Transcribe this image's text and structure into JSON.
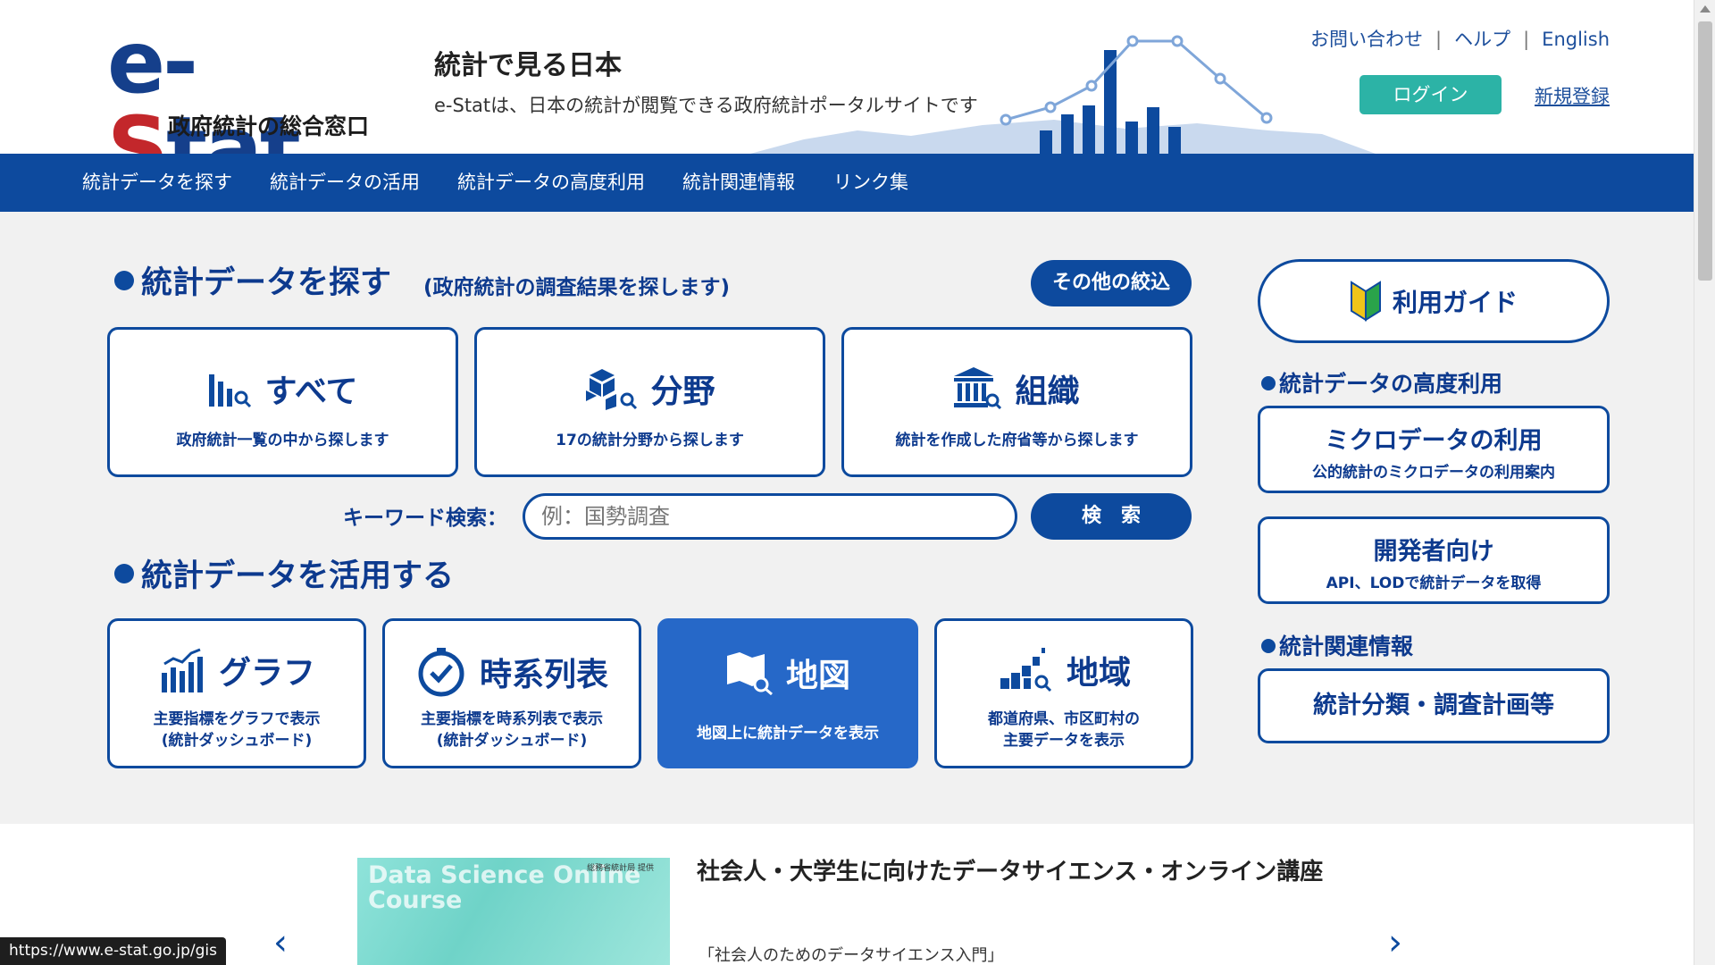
{
  "header": {
    "logo_main": "e-Stat",
    "logo_sub": "政府統計の総合窓口",
    "title": "統計で見る日本",
    "description": "e-Statは、日本の統計が閲覧できる政府統計ポータルサイトです",
    "contact": "お問い合わせ",
    "help": "ヘルプ",
    "english": "English",
    "separator": "|",
    "login": "ログイン",
    "register": "新規登録"
  },
  "nav": {
    "items": [
      "統計データを探す",
      "統計データの活用",
      "統計データの高度利用",
      "統計関連情報",
      "リンク集"
    ]
  },
  "search_section": {
    "heading": "統計データを探す",
    "note": "(政府統計の調査結果を探します)",
    "filter_button": "その他の絞込",
    "cards": [
      {
        "title": "すべて",
        "desc": "政府統計一覧の中から探します"
      },
      {
        "title": "分野",
        "desc": "17の統計分野から探します"
      },
      {
        "title": "組織",
        "desc": "統計を作成した府省等から探します"
      }
    ],
    "keyword_label": "キーワード検索：",
    "keyword_placeholder": "例：国勢調査",
    "search_button": "検　索"
  },
  "use_section": {
    "heading": "統計データを活用する",
    "cards": [
      {
        "title": "グラフ",
        "desc1": "主要指標をグラフで表示",
        "desc2": "(統計ダッシュボード)"
      },
      {
        "title": "時系列表",
        "desc1": "主要指標を時系列表で表示",
        "desc2": "(統計ダッシュボード)"
      },
      {
        "title": "地図",
        "desc1": "地図上に統計データを表示",
        "desc2": ""
      },
      {
        "title": "地域",
        "desc1": "都道府県、市区町村の",
        "desc2": "主要データを表示"
      }
    ]
  },
  "right": {
    "guide": "利用ガイド",
    "advanced_heading": "統計データの高度利用",
    "micro_title": "ミクロデータの利用",
    "micro_desc": "公的統計のミクロデータの利用案内",
    "dev_title": "開発者向け",
    "dev_desc": "API、LODで統計データを取得",
    "related_heading": "統計関連情報",
    "classification": "統計分類・調査計画等"
  },
  "news": {
    "image_text": "Data Science Online Course",
    "image_provider": "総務省統計局 提供",
    "title": "社会人・大学生に向けたデータサイエンス・オンライン講座",
    "subtitle": "「社会人のためのデータサイエンス入門」",
    "prev": "‹",
    "next": "›"
  },
  "status_url": "https://www.e-stat.go.jp/gis",
  "colors": {
    "primary": "#0d4a9e",
    "teal": "#2cb3a6",
    "logo_red": "#c3272b",
    "active_card": "#2668c8"
  }
}
